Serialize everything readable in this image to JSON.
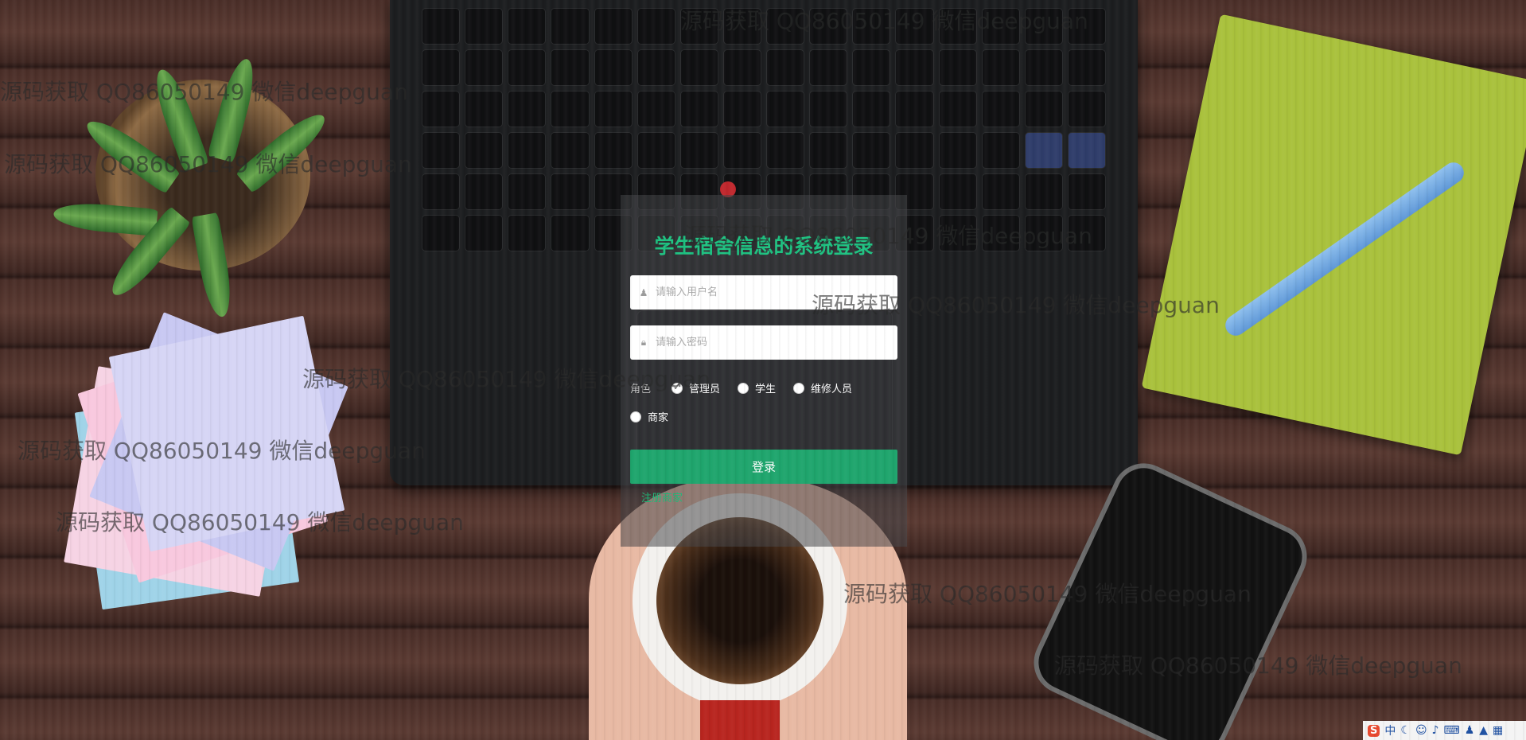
{
  "login": {
    "title": "学生宿舍信息的系统登录",
    "username_placeholder": "请输入用户名",
    "password_placeholder": "请输入密码",
    "role_label": "角色",
    "roles": [
      "管理员",
      "学生",
      "维修人员",
      "商家"
    ],
    "selected_role": "管理员",
    "submit_label": "登录",
    "register_label": "注册商家"
  },
  "watermark_text": "源码获取 QQ86050149 微信deepguan",
  "tray": {
    "ime_label": "S",
    "lang_label": "中",
    "icons": [
      "moon-icon",
      "emoji-icon",
      "mic-icon",
      "keyboard-icon",
      "person-icon",
      "shirt-icon",
      "grid-icon"
    ]
  },
  "accent_color": "#1fa56d"
}
